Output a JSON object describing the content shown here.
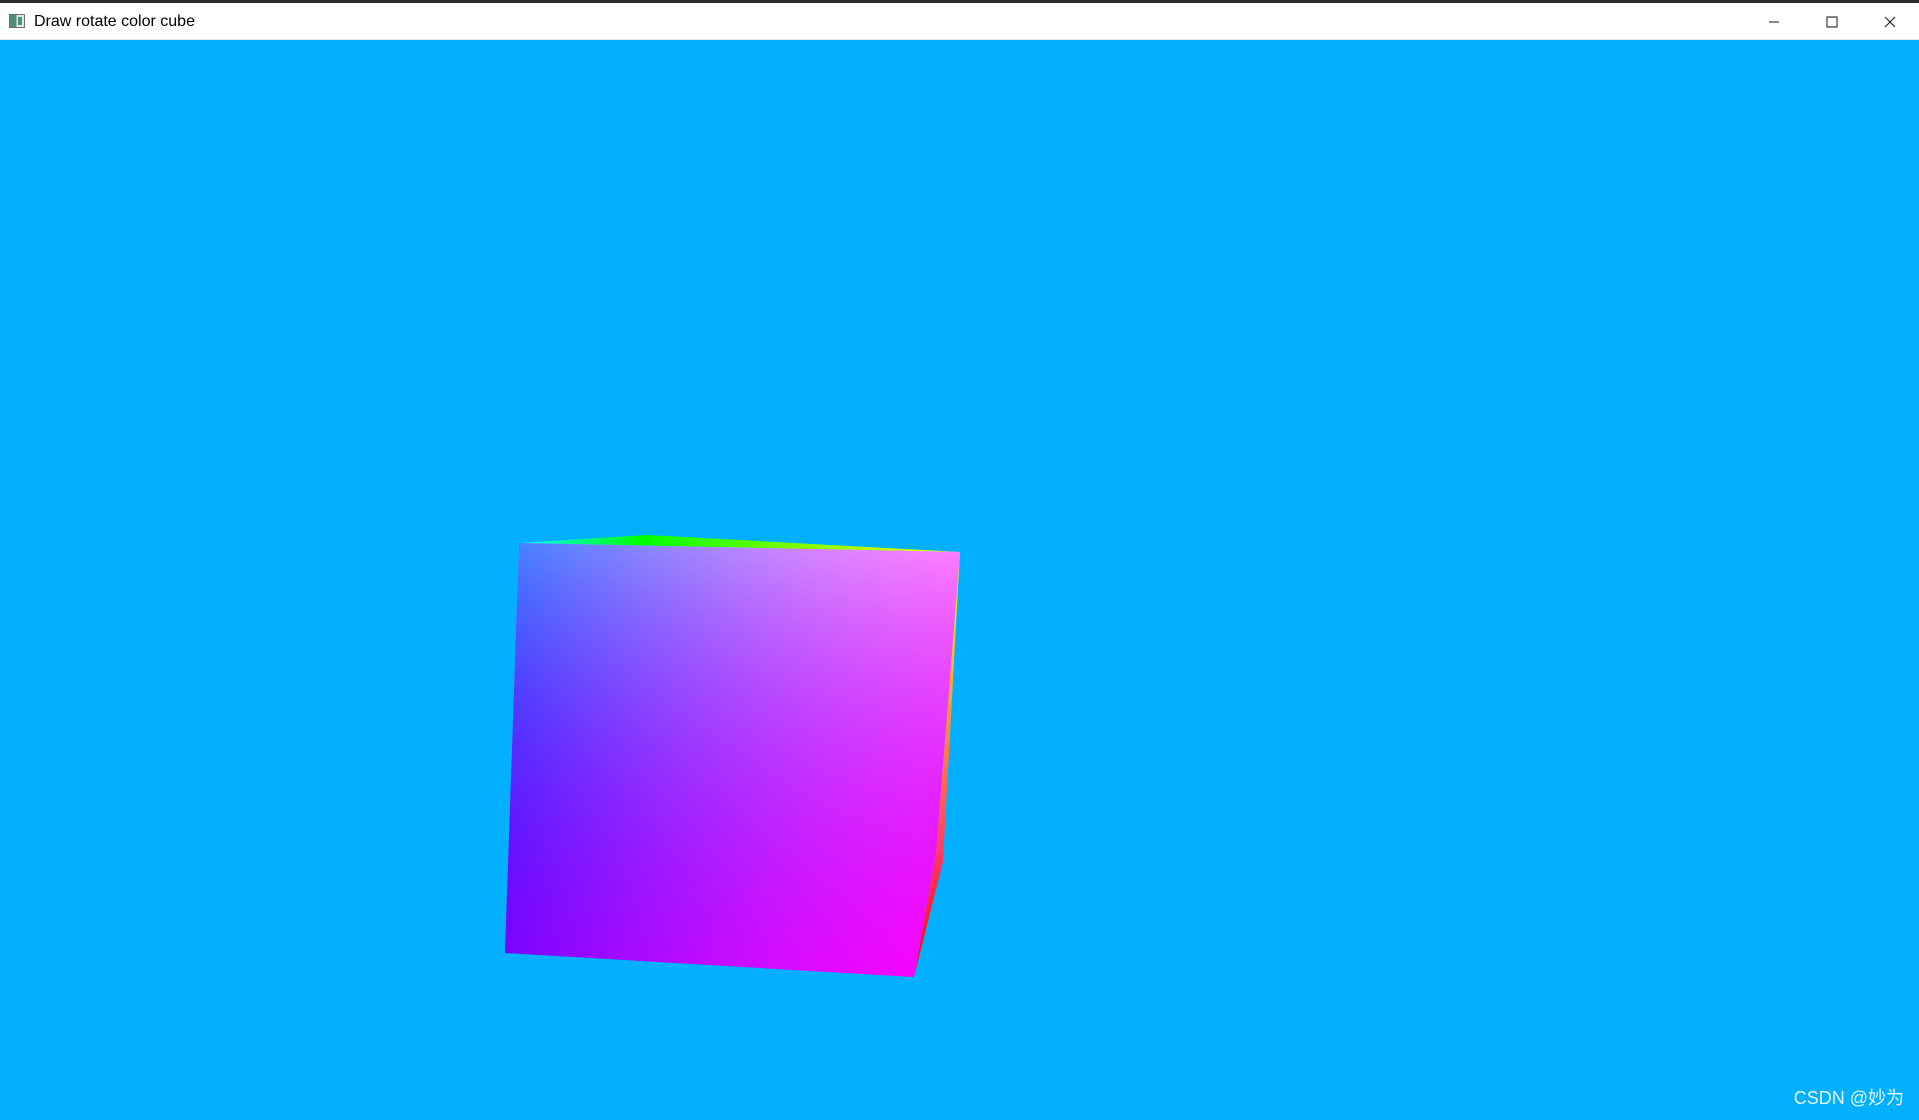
{
  "window": {
    "title": "Draw rotate color cube",
    "background_color": "#02b0ff",
    "icons": {
      "app": "app-window-icon",
      "minimize": "minimize-icon",
      "maximize": "maximize-icon",
      "close": "close-icon"
    }
  },
  "scene": {
    "object": "color-cube",
    "face_colors": {
      "front_top_left": "#00ffff",
      "front_top_right": "#ffffff",
      "front_bottom_left": "#0000ff",
      "front_bottom_right": "#ff00ff",
      "top_back_edge": "#00ff00",
      "right_top": "#ffff00",
      "right_bottom": "#ff0000"
    }
  },
  "watermark": {
    "text": "CSDN @妙为"
  }
}
